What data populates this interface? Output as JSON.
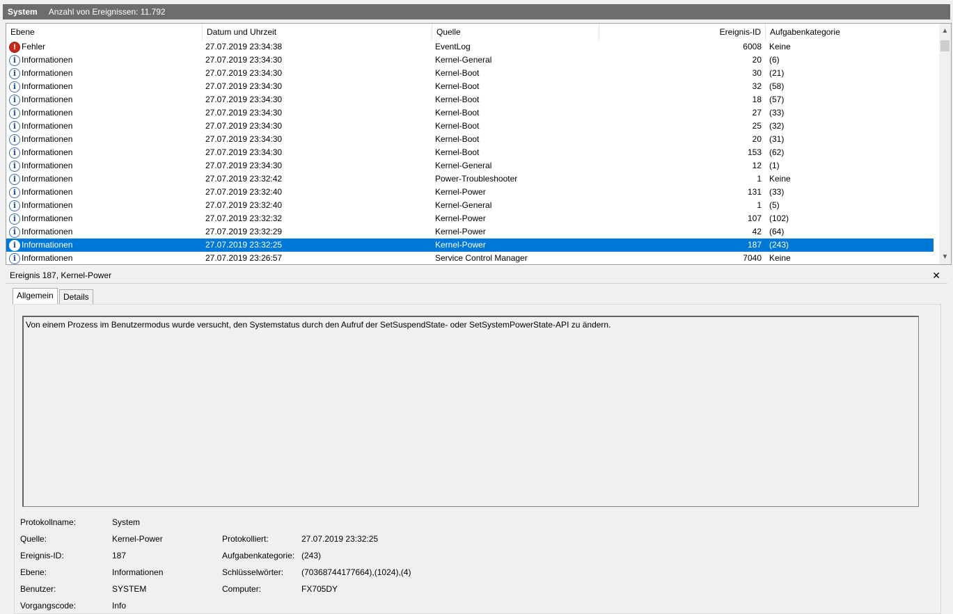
{
  "header": {
    "log_name": "System",
    "event_count_label": "Anzahl von Ereignissen: 11.792"
  },
  "columns": {
    "level": "Ebene",
    "date": "Datum und Uhrzeit",
    "source": "Quelle",
    "id": "Ereignis-ID",
    "category": "Aufgabenkategorie"
  },
  "rows": [
    {
      "icon": "error-icon",
      "level": "Fehler",
      "date": "27.07.2019 23:34:38",
      "source": "EventLog",
      "id": "6008",
      "category": "Keine"
    },
    {
      "icon": "info-icon",
      "level": "Informationen",
      "date": "27.07.2019 23:34:30",
      "source": "Kernel-General",
      "id": "20",
      "category": "(6)"
    },
    {
      "icon": "info-icon",
      "level": "Informationen",
      "date": "27.07.2019 23:34:30",
      "source": "Kernel-Boot",
      "id": "30",
      "category": "(21)"
    },
    {
      "icon": "info-icon",
      "level": "Informationen",
      "date": "27.07.2019 23:34:30",
      "source": "Kernel-Boot",
      "id": "32",
      "category": "(58)"
    },
    {
      "icon": "info-icon",
      "level": "Informationen",
      "date": "27.07.2019 23:34:30",
      "source": "Kernel-Boot",
      "id": "18",
      "category": "(57)"
    },
    {
      "icon": "info-icon",
      "level": "Informationen",
      "date": "27.07.2019 23:34:30",
      "source": "Kernel-Boot",
      "id": "27",
      "category": "(33)"
    },
    {
      "icon": "info-icon",
      "level": "Informationen",
      "date": "27.07.2019 23:34:30",
      "source": "Kernel-Boot",
      "id": "25",
      "category": "(32)"
    },
    {
      "icon": "info-icon",
      "level": "Informationen",
      "date": "27.07.2019 23:34:30",
      "source": "Kernel-Boot",
      "id": "20",
      "category": "(31)"
    },
    {
      "icon": "info-icon",
      "level": "Informationen",
      "date": "27.07.2019 23:34:30",
      "source": "Kernel-Boot",
      "id": "153",
      "category": "(62)"
    },
    {
      "icon": "info-icon",
      "level": "Informationen",
      "date": "27.07.2019 23:34:30",
      "source": "Kernel-General",
      "id": "12",
      "category": "(1)"
    },
    {
      "icon": "info-icon",
      "level": "Informationen",
      "date": "27.07.2019 23:32:42",
      "source": "Power-Troubleshooter",
      "id": "1",
      "category": "Keine"
    },
    {
      "icon": "info-icon",
      "level": "Informationen",
      "date": "27.07.2019 23:32:40",
      "source": "Kernel-Power",
      "id": "131",
      "category": "(33)"
    },
    {
      "icon": "info-icon",
      "level": "Informationen",
      "date": "27.07.2019 23:32:40",
      "source": "Kernel-General",
      "id": "1",
      "category": "(5)"
    },
    {
      "icon": "info-icon",
      "level": "Informationen",
      "date": "27.07.2019 23:32:32",
      "source": "Kernel-Power",
      "id": "107",
      "category": "(102)"
    },
    {
      "icon": "info-icon",
      "level": "Informationen",
      "date": "27.07.2019 23:32:29",
      "source": "Kernel-Power",
      "id": "42",
      "category": "(64)"
    },
    {
      "icon": "info-icon",
      "level": "Informationen",
      "date": "27.07.2019 23:32:25",
      "source": "Kernel-Power",
      "id": "187",
      "category": "(243)",
      "selected": true
    },
    {
      "icon": "info-icon",
      "level": "Informationen",
      "date": "27.07.2019 23:26:57",
      "source": "Service Control Manager",
      "id": "7040",
      "category": "Keine"
    }
  ],
  "detail": {
    "title": "Ereignis 187, Kernel-Power",
    "close": "✕",
    "tabs": [
      "Allgemein",
      "Details"
    ],
    "message": "Von einem Prozess im Benutzermodus wurde versucht, den Systemstatus durch den Aufruf der SetSuspendState- oder SetSystemPowerState-API zu ändern.",
    "fields": {
      "log_name_label": "Protokollname:",
      "log_name": "System",
      "source_label": "Quelle:",
      "source": "Kernel-Power",
      "logged_label": "Protokolliert:",
      "logged": "27.07.2019 23:32:25",
      "event_id_label": "Ereignis-ID:",
      "event_id": "187",
      "category_label": "Aufgabenkategorie:",
      "category": "(243)",
      "level_label": "Ebene:",
      "level": "Informationen",
      "keywords_label": "Schlüsselwörter:",
      "keywords": "(70368744177664),(1024),(4)",
      "user_label": "Benutzer:",
      "user": "SYSTEM",
      "computer_label": "Computer:",
      "computer": "FX705DY",
      "opcode_label": "Vorgangscode:",
      "opcode": "Info"
    }
  },
  "colors": {
    "selection": "#0078d7",
    "titlebar": "#6d6d6d",
    "error": "#c42b1c"
  }
}
